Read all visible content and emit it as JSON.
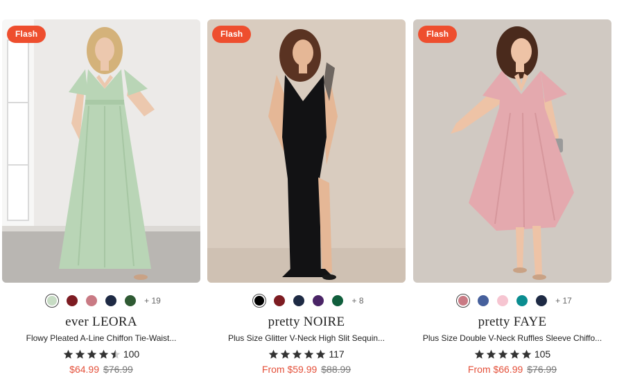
{
  "products": [
    {
      "badge": "Flash",
      "image_alt": "Woman wearing sage green long chiffon dress",
      "swatches": [
        "#c7dcc4",
        "#7d1c22",
        "#c97a84",
        "#1e2a44",
        "#2f5a33"
      ],
      "selected_swatch": 0,
      "more_colors": "+ 19",
      "brand": "ever LEORA",
      "name": "Flowy Pleated A-Line Chiffon Tie-Waist...",
      "rating": 4.5,
      "review_count": "100",
      "price": "$64.99",
      "original_price": "$76.99",
      "colors": {
        "bg": "#e7e7e6",
        "dress": "#b9d5b6",
        "skin": "#ecc8ae",
        "hair": "#d4b27a"
      }
    },
    {
      "badge": "Flash",
      "image_alt": "Woman wearing black glitter v-neck slit gown",
      "swatches": [
        "#000000",
        "#7d1c22",
        "#1e2a44",
        "#4a2466",
        "#105e3c"
      ],
      "selected_swatch": 0,
      "more_colors": "+ 8",
      "brand": "pretty NOIRE",
      "name": "Plus Size Glitter V-Neck High Slit Sequin...",
      "rating": 5,
      "review_count": "117",
      "price": "From $59.99",
      "original_price": "$88.99",
      "colors": {
        "bg": "#d8cabc",
        "dress": "#121214",
        "skin": "#e5b796",
        "hair": "#5a3322"
      }
    },
    {
      "badge": "Flash",
      "image_alt": "Woman wearing dusty pink ruffle sleeve midi dress",
      "swatches": [
        "#c97a84",
        "#46609c",
        "#f6c5d1",
        "#0a8d90",
        "#1e2a44"
      ],
      "selected_swatch": 0,
      "more_colors": "+ 17",
      "brand": "pretty FAYE",
      "name": "Plus Size Double V-Neck Ruffles Sleeve Chiffo...",
      "rating": 5,
      "review_count": "105",
      "price": "From $66.99",
      "original_price": "$76.99",
      "colors": {
        "bg": "#cfc8c1",
        "dress": "#e4a9ae",
        "skin": "#eec3a6",
        "hair": "#4a2a1c"
      }
    }
  ]
}
